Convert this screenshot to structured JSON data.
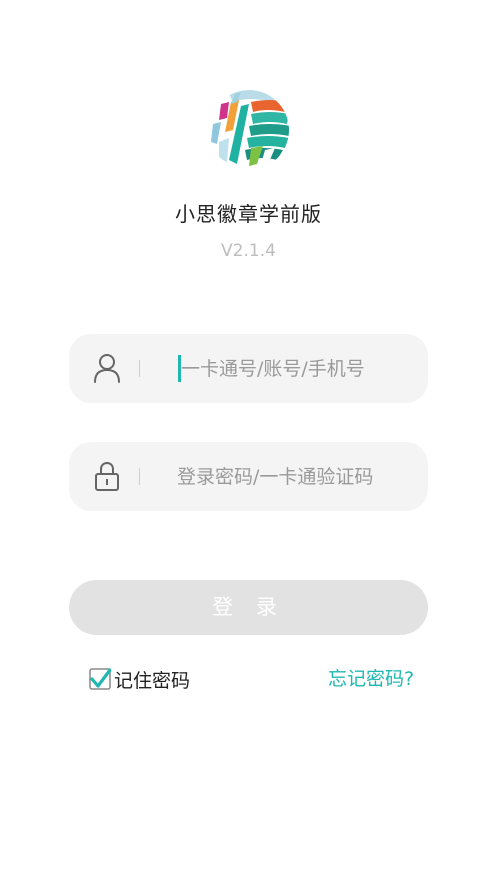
{
  "app": {
    "name": "小思徽章学前版",
    "version": "V2.1.4",
    "logo_icon": "xiaosi-badge-logo-icon"
  },
  "account": {
    "icon": "user-icon",
    "placeholder": "一卡通号/账号/手机号",
    "value": ""
  },
  "password": {
    "icon": "lock-icon",
    "placeholder": "登录密码/一卡通验证码",
    "value": ""
  },
  "login_button": {
    "label": "登 录"
  },
  "remember": {
    "label": "记住密码",
    "checked": true
  },
  "forgot": {
    "label": "忘记密码?"
  },
  "colors": {
    "accent": "#1fb8b0",
    "field_bg": "#f4f4f4",
    "button_disabled": "#e2e2e2"
  }
}
